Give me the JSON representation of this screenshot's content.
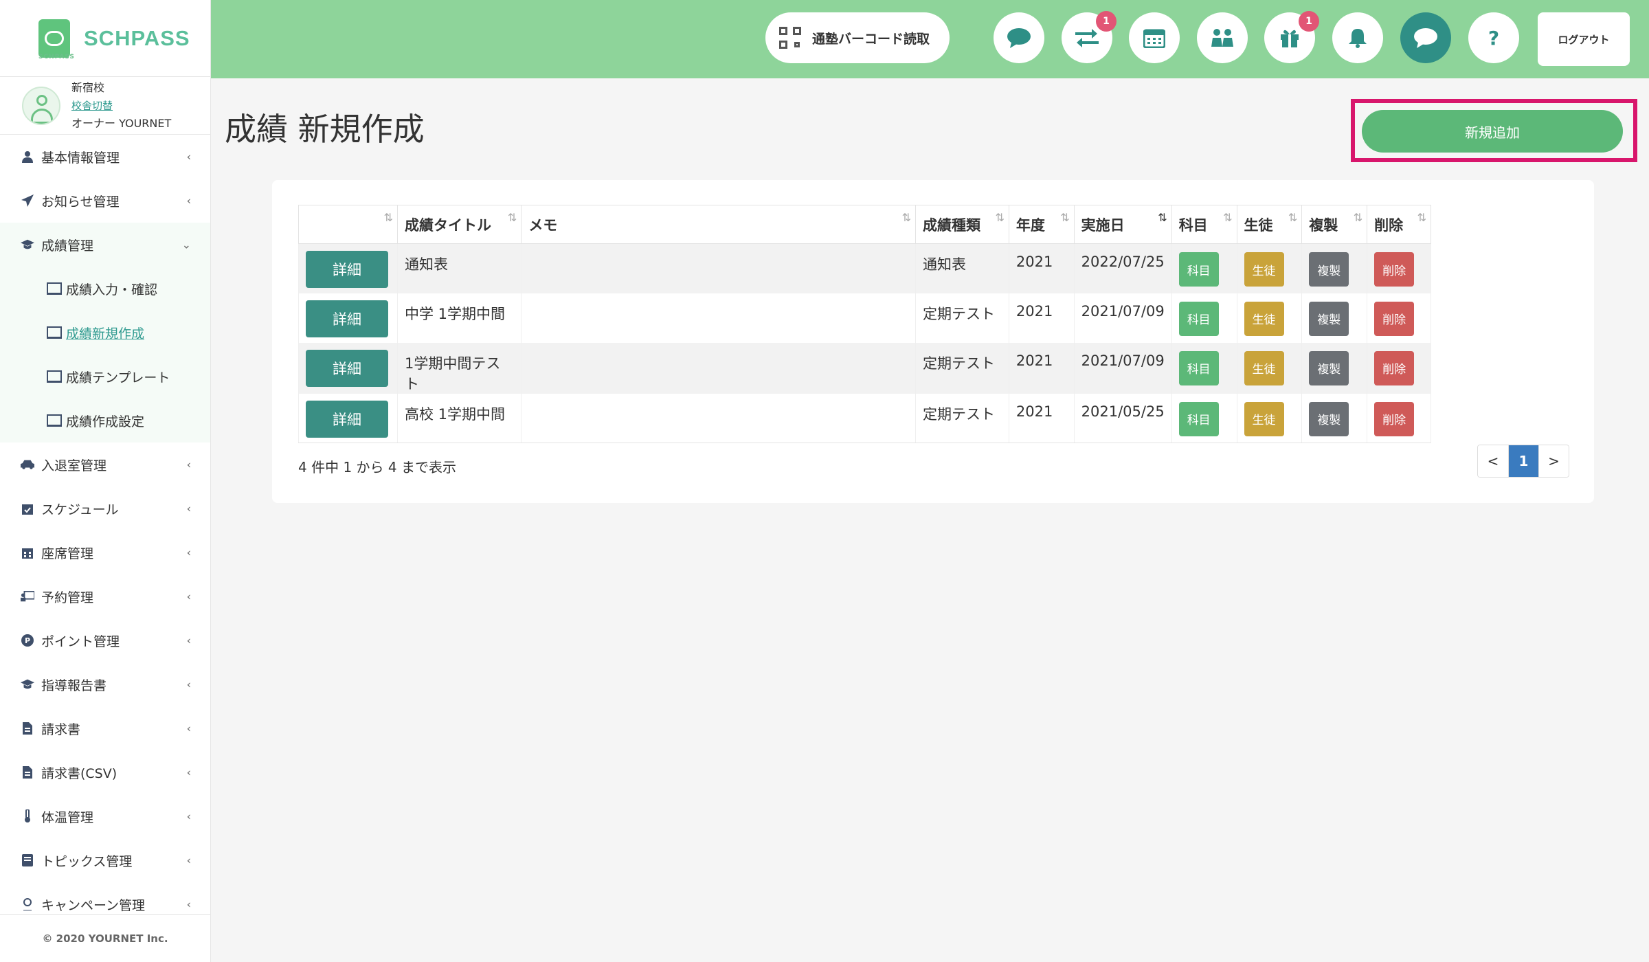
{
  "brand": {
    "name": "SCHPASS",
    "sub": "SCHPASS"
  },
  "user": {
    "campus": "新宿校",
    "switch_label": "校舎切替",
    "owner": "オーナー YOURNET"
  },
  "sidebar": {
    "items": [
      {
        "label": "基本情報管理",
        "icon": "user-icon"
      },
      {
        "label": "お知らせ管理",
        "icon": "paper-plane-icon"
      },
      {
        "label": "成績管理",
        "icon": "graduation-cap-icon"
      },
      {
        "label": "入退室管理",
        "icon": "car-icon"
      },
      {
        "label": "スケジュール",
        "icon": "calendar-check-icon"
      },
      {
        "label": "座席管理",
        "icon": "calendar-icon"
      },
      {
        "label": "予約管理",
        "icon": "chalkboard-icon"
      },
      {
        "label": "ポイント管理",
        "icon": "point-icon"
      },
      {
        "label": "指導報告書",
        "icon": "graduation-cap-icon"
      },
      {
        "label": "請求書",
        "icon": "invoice-icon"
      },
      {
        "label": "請求書(CSV)",
        "icon": "invoice-icon"
      },
      {
        "label": "体温管理",
        "icon": "thermometer-icon"
      },
      {
        "label": "トピックス管理",
        "icon": "book-icon"
      },
      {
        "label": "キャンペーン管理",
        "icon": "campaign-icon"
      }
    ],
    "sub_items": [
      {
        "label": "成績入力・確認"
      },
      {
        "label": "成績新規作成"
      },
      {
        "label": "成績テンプレート"
      },
      {
        "label": "成績作成設定"
      }
    ],
    "footer": "© 2020 YOURNET Inc."
  },
  "header": {
    "barcode_label": "通塾バーコード読取",
    "logout_label": "ログアウト",
    "badges": {
      "transfer": "1",
      "gift": "1"
    },
    "help_label": "?"
  },
  "page": {
    "title": "成績 新規作成",
    "add_button": "新規追加"
  },
  "table": {
    "columns": [
      "",
      "成績タイトル",
      "メモ",
      "成績種類",
      "年度",
      "実施日",
      "科目",
      "生徒",
      "複製",
      "削除"
    ],
    "sort_glyph": "⇅",
    "rows": [
      {
        "title": "通知表",
        "memo": "",
        "type": "通知表",
        "year": "2021",
        "date": "2022/07/25"
      },
      {
        "title": "中学 1学期中間",
        "memo": "",
        "type": "定期テスト",
        "year": "2021",
        "date": "2021/07/09"
      },
      {
        "title": "1学期中間テスト",
        "memo": "",
        "type": "定期テスト",
        "year": "2021",
        "date": "2021/07/09"
      },
      {
        "title": "高校 1学期中間",
        "memo": "",
        "type": "定期テスト",
        "year": "2021",
        "date": "2021/05/25"
      }
    ],
    "buttons": {
      "detail": "詳細",
      "subject": "科目",
      "student": "生徒",
      "copy": "複製",
      "delete": "削除"
    }
  },
  "pagination": {
    "summary": "4 件中 1 から 4 まで表示",
    "prev": "<",
    "current": "1",
    "next": ">"
  }
}
